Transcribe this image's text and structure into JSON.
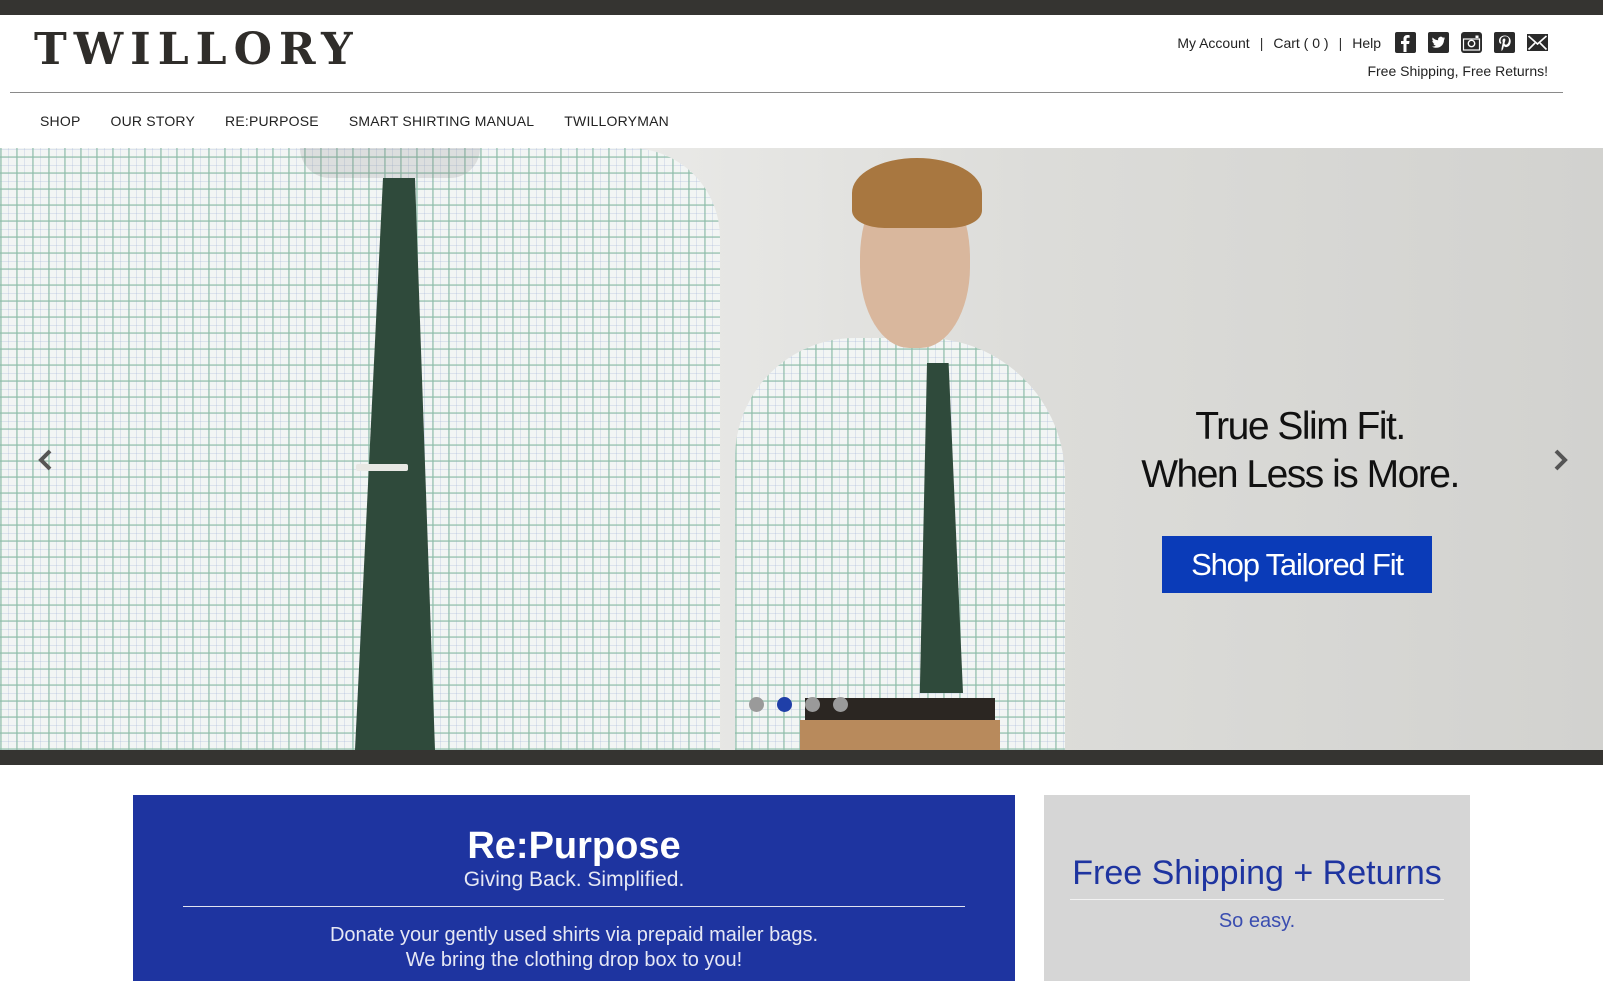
{
  "brand": {
    "logo_text": "TWILLORY"
  },
  "utility_nav": {
    "my_account": "My Account",
    "cart": "Cart ( 0 )",
    "help": "Help",
    "separator": "|",
    "social_icons": [
      "facebook-icon",
      "twitter-icon",
      "instagram-icon",
      "pinterest-icon",
      "email-icon"
    ]
  },
  "tagline": "Free Shipping, Free Returns!",
  "main_nav": [
    "SHOP",
    "OUR STORY",
    "RE:PURPOSE",
    "SMART SHIRTING MANUAL",
    "TWILLORYMAN"
  ],
  "hero": {
    "line1": "True Slim Fit.",
    "line2": "When Less is More.",
    "cta_label": "Shop Tailored Fit",
    "slides": 4,
    "active_slide": 2
  },
  "promos": {
    "repurpose": {
      "title": "Re:Purpose",
      "subtitle": "Giving Back. Simplified.",
      "body_line1": "Donate your gently used shirts via prepaid mailer bags.",
      "body_line2": "We bring the clothing drop box to you!"
    },
    "shipping": {
      "title": "Free Shipping + Returns",
      "subtitle": "So easy."
    }
  },
  "colors": {
    "accent_blue": "#0a3bb8",
    "promo_blue": "#1e34a0",
    "dark_bar": "#353431",
    "promo_grey": "#d6d6d6"
  }
}
